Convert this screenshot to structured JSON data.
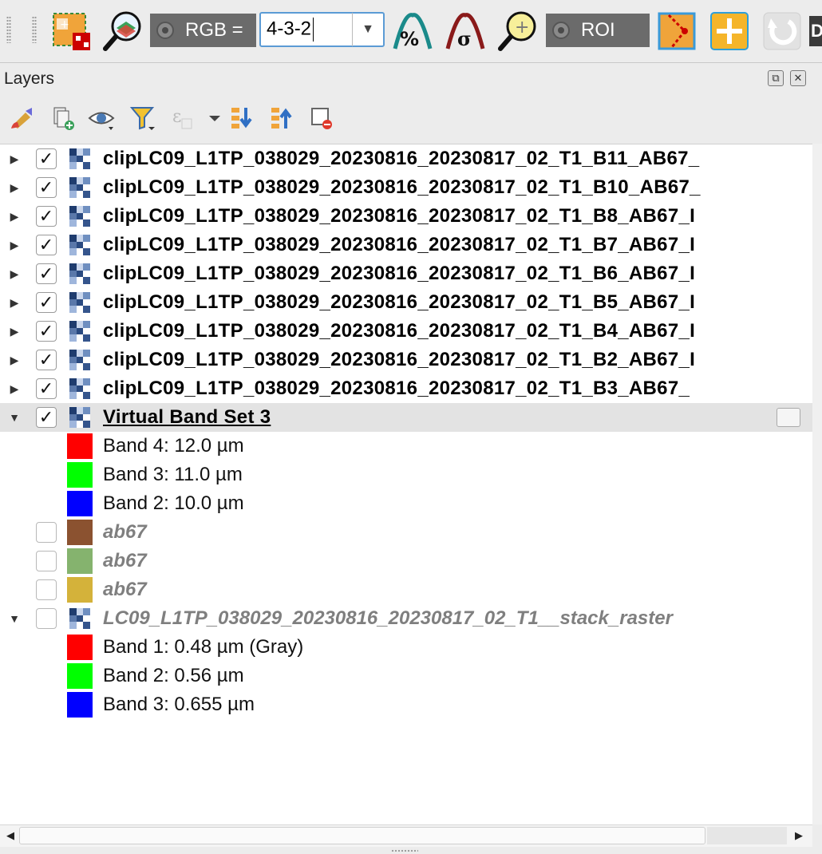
{
  "toolbar": {
    "rgb_label": "RGB =",
    "rgb_value": "4-3-2",
    "roi_label": "ROI",
    "partial_edge_letter": "D"
  },
  "panel": {
    "title": "Layers",
    "restore_symbol": "⧉",
    "close_symbol": "✕"
  },
  "layers": [
    {
      "type": "raster",
      "label": "clipLC09_L1TP_038029_20230816_20230817_02_T1_B11_AB67_",
      "checked": true
    },
    {
      "type": "raster",
      "label": "clipLC09_L1TP_038029_20230816_20230817_02_T1_B10_AB67_",
      "checked": true
    },
    {
      "type": "raster",
      "label": "clipLC09_L1TP_038029_20230816_20230817_02_T1_B8_AB67_I",
      "checked": true
    },
    {
      "type": "raster",
      "label": "clipLC09_L1TP_038029_20230816_20230817_02_T1_B7_AB67_I",
      "checked": true
    },
    {
      "type": "raster",
      "label": "clipLC09_L1TP_038029_20230816_20230817_02_T1_B6_AB67_I",
      "checked": true
    },
    {
      "type": "raster",
      "label": "clipLC09_L1TP_038029_20230816_20230817_02_T1_B5_AB67_I",
      "checked": true
    },
    {
      "type": "raster",
      "label": "clipLC09_L1TP_038029_20230816_20230817_02_T1_B4_AB67_I",
      "checked": true
    },
    {
      "type": "raster",
      "label": "clipLC09_L1TP_038029_20230816_20230817_02_T1_B2_AB67_I",
      "checked": true
    },
    {
      "type": "raster",
      "label": "clipLC09_L1TP_038029_20230816_20230817_02_T1_B3_AB67_",
      "checked": true
    },
    {
      "type": "group",
      "label": "Virtual Band Set  3",
      "checked": true
    },
    {
      "type": "band",
      "label": "Band 4: 12.0  µm",
      "color": "#ff0000"
    },
    {
      "type": "band",
      "label": "Band 3: 11.0  µm",
      "color": "#00ff00"
    },
    {
      "type": "band",
      "label": "Band 2: 10.0  µm",
      "color": "#0000ff"
    },
    {
      "type": "vector",
      "label": "ab67",
      "color": "#8b5230"
    },
    {
      "type": "vector",
      "label": "ab67",
      "color": "#85b36e"
    },
    {
      "type": "vector",
      "label": "ab67",
      "color": "#d4b23a"
    },
    {
      "type": "stack",
      "label": "LC09_L1TP_038029_20230816_20230817_02_T1__stack_raster"
    },
    {
      "type": "band",
      "label": "Band 1: 0.48  µm (Gray)",
      "color": "#ff0000"
    },
    {
      "type": "band",
      "label": "Band 2: 0.56  µm",
      "color": "#00ff00"
    },
    {
      "type": "band",
      "label": "Band 3: 0.655 µm",
      "color": "#0000ff"
    }
  ],
  "colors": {
    "selected_row": "#e3e3e3",
    "accent_orange": "#f5a623",
    "toolbar_segment": "#6b6b6b"
  }
}
